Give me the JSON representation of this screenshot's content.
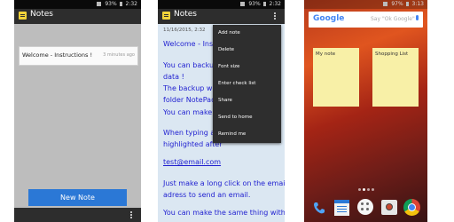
{
  "phone1": {
    "status": {
      "battery": "93%",
      "time": "2:32"
    },
    "app_title": "Notes",
    "note": {
      "title": "Welcome - Instructions !",
      "time": "3 minutes ago"
    },
    "new_note_label": "New Note"
  },
  "phone2": {
    "status": {
      "battery": "93%",
      "time": "2:32"
    },
    "app_title": "Notes",
    "date": "11/16/2015, 2:32",
    "lines": [
      "Welcome - Instructions !",
      "You can backup",
      "data !",
      "The backup will",
      "folder NotePad",
      "You can make a",
      "When typing an",
      "highlighted after",
      "test@email.com",
      "Just make a long click on the email",
      "adress to send an email.",
      "You can make the same thing with a"
    ],
    "menu": [
      "Add note",
      "Delete",
      "Font size",
      "Enter check list",
      "Share",
      "Send to home",
      "Remind me"
    ]
  },
  "phone3": {
    "status": {
      "battery": "97%",
      "time": "3:13"
    },
    "search_placeholder": "Say \"Ok Google\"",
    "google_logo": "Google",
    "widgets": [
      {
        "title": "My note"
      },
      {
        "title": "Shopping List"
      }
    ]
  },
  "colors": {
    "appbar": "#2d2d2d",
    "accent": "#2b78d6",
    "list_bg": "#bdbdbd",
    "note_bg": "#f8f0a7",
    "note_text": "#1f1fd0"
  }
}
